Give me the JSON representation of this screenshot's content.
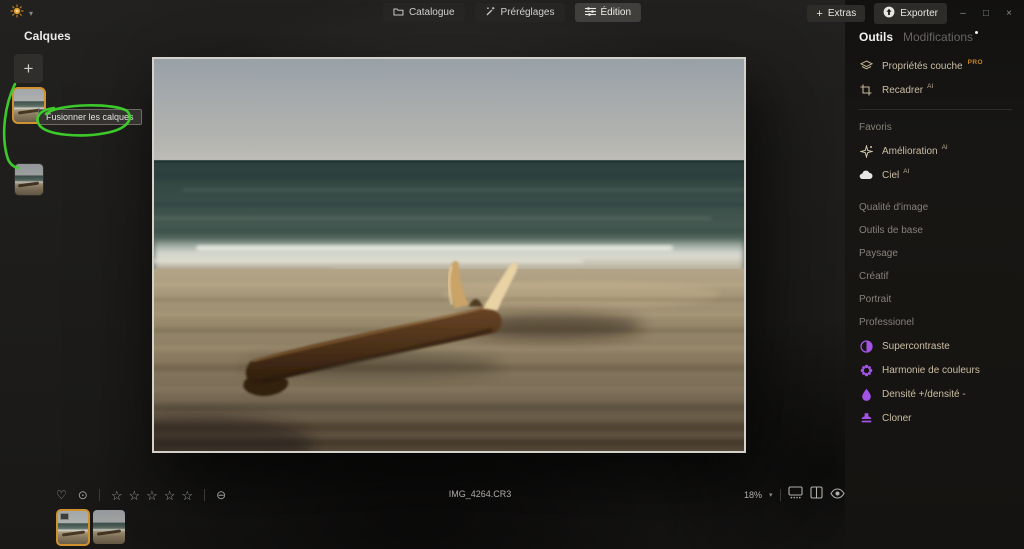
{
  "titlebar": {
    "tabs": [
      {
        "label": "Catalogue",
        "icon": "folder-icon",
        "active": false
      },
      {
        "label": "Préréglages",
        "icon": "wand-icon",
        "active": false
      },
      {
        "label": "Édition",
        "icon": "sliders-icon",
        "active": true
      }
    ],
    "extras_button": "Extras",
    "export_button": "Exporter",
    "window_controls": {
      "minimize": "–",
      "maximize": "□",
      "close": "×"
    }
  },
  "layers_panel": {
    "title": "Calques",
    "add_button": "+",
    "merge_tooltip": "Fusionner les calques",
    "layer_count": 2,
    "selected_layer_index": 0
  },
  "tools_panel": {
    "tabs": [
      {
        "label": "Outils",
        "active": true
      },
      {
        "label": "Modifications",
        "active": false,
        "notification_dot": true
      }
    ],
    "items": [
      {
        "type": "tool",
        "label": "Propriétés couche",
        "icon": "layer-properties-icon",
        "badge": "PRO"
      },
      {
        "type": "tool",
        "label": "Recadrer",
        "icon": "crop-icon",
        "sup": "AI"
      },
      {
        "type": "header",
        "label": "Favoris"
      },
      {
        "type": "tool",
        "label": "Amélioration",
        "icon": "enhance-icon",
        "sup": "AI"
      },
      {
        "type": "tool",
        "label": "Ciel",
        "icon": "cloud-icon",
        "sup": "AI"
      },
      {
        "type": "header",
        "label": "Qualité d'image"
      },
      {
        "type": "header",
        "label": "Outils de base"
      },
      {
        "type": "header",
        "label": "Paysage"
      },
      {
        "type": "header",
        "label": "Créatif"
      },
      {
        "type": "header",
        "label": "Portrait"
      },
      {
        "type": "header",
        "label": "Professionel"
      },
      {
        "type": "tool",
        "label": "Supercontraste",
        "icon": "contrast-icon"
      },
      {
        "type": "tool",
        "label": "Harmonie de couleurs",
        "icon": "color-harmony-icon"
      },
      {
        "type": "tool",
        "label": "Densité +/densité -",
        "icon": "dodge-burn-icon"
      },
      {
        "type": "tool",
        "label": "Cloner",
        "icon": "clone-stamp-icon"
      }
    ]
  },
  "bottom_bar": {
    "filename": "IMG_4264.CR3",
    "zoom_level": "18%",
    "star_count": 5
  },
  "photo": {
    "description": "Motion-blurred beach scene with driftwood log on sand"
  },
  "glyphs": {
    "heart": "♡",
    "reject": "⊙",
    "star": "☆",
    "no_label": "⊖",
    "chevron_down": "▾",
    "plus": "+"
  },
  "colors": {
    "selection_orange": "#d0922f",
    "tool_purple": "#a254e6",
    "annotation_green": "#3ed32b",
    "pro_badge": "#c9861f"
  }
}
